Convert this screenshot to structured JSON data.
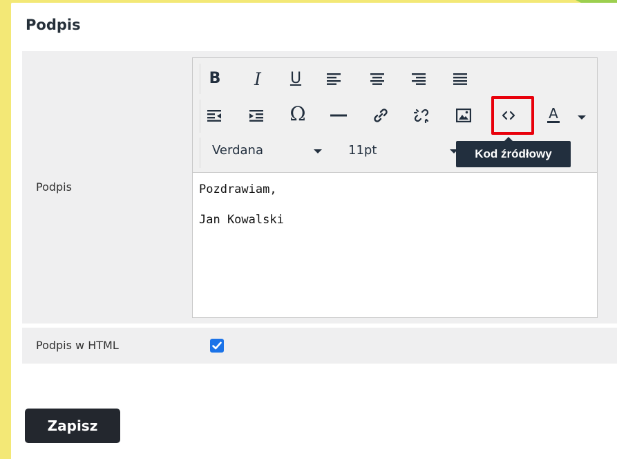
{
  "section": {
    "title": "Podpis"
  },
  "form": {
    "signature_label": "Podpis",
    "html_label": "Podpis w HTML",
    "html_checked": true
  },
  "editor": {
    "toolbar": {
      "bold": "B",
      "italic": "I",
      "underline": "U",
      "special_char": "Ω",
      "font_family": "Verdana",
      "font_size": "11pt",
      "text_color": "A"
    },
    "tooltip": "Kod źródłowy",
    "content_lines": [
      "Pozdrawiam,",
      "",
      "Jan Kowalski"
    ],
    "icons": [
      "align-left-icon",
      "align-center-icon",
      "align-right-icon",
      "align-justify-icon",
      "outdent-icon",
      "indent-icon",
      "special-character-icon",
      "horizontal-line-icon",
      "link-icon",
      "unlink-icon",
      "image-icon",
      "source-code-icon",
      "text-color-icon"
    ]
  },
  "save_button": {
    "label": "Zapisz"
  },
  "colors": {
    "background_accent": "#f3e876",
    "highlight": "#e8000b",
    "checkbox": "#1b73e8",
    "button": "#23272e"
  }
}
